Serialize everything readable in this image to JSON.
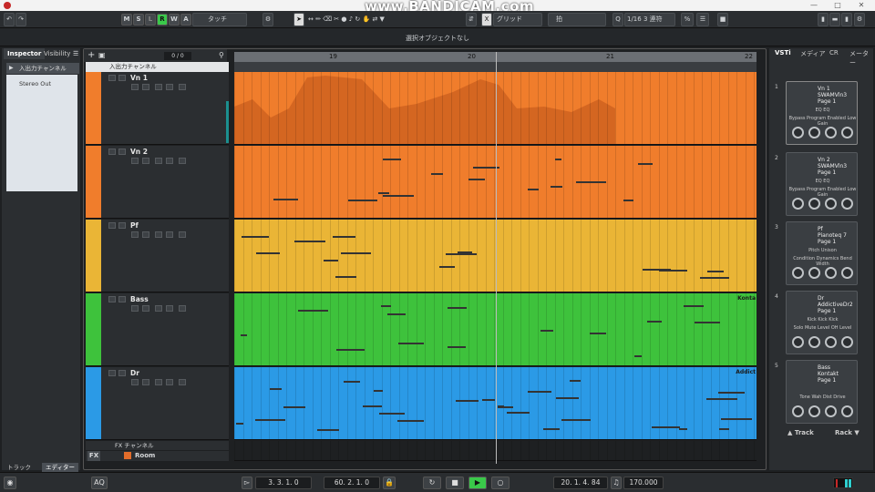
{
  "window": {
    "watermark": "www.BANDICAM.com",
    "min_btn": "—",
    "max_btn": "□",
    "close_btn": "✕"
  },
  "toolbar": {
    "modes": [
      "M",
      "S",
      "L",
      "R",
      "W",
      "A"
    ],
    "automation": "タッチ",
    "snap_label": "グリッド",
    "grid_type": "拍",
    "quantize": "1/16 3 連符"
  },
  "info": {
    "status": "選択オブジェクトなし"
  },
  "inspector": {
    "tabs": [
      "Inspector",
      "Visibility"
    ],
    "channel": "入出力チャンネル",
    "output": "Stereo Out",
    "bottom_tabs": [
      "トラック",
      "エディター"
    ]
  },
  "project": {
    "track_count": "0 / 0",
    "io_channel": "入出力チャンネル",
    "ruler": [
      "19",
      "20",
      "21",
      "22"
    ],
    "tracks": [
      {
        "name": "Vn 1",
        "color": "#f07d2c"
      },
      {
        "name": "Vn 2",
        "color": "#f07d2c"
      },
      {
        "name": "Pf",
        "color": "#eab536"
      },
      {
        "name": "Bass",
        "color": "#3ec23c"
      },
      {
        "name": "Dr",
        "color": "#2b9ae6"
      }
    ],
    "part_labels": {
      "bass": "Konta",
      "dr": "Addict"
    },
    "fx_channel": "FX チャンネル",
    "fx_track": "Room",
    "fx_label": "FX"
  },
  "rack": {
    "tabs": [
      "VSTi",
      "メディア",
      "CR",
      "メーター"
    ],
    "instruments": [
      {
        "num": "1",
        "name": "Vn 1",
        "plugin": "SWAMVln3",
        "page": "Page 1",
        "params": "Bypass  Program  Enabled  Low Gain",
        "extra": "EQ      EQ"
      },
      {
        "num": "2",
        "name": "Vn 2",
        "plugin": "SWAMVln3",
        "page": "Page 1",
        "params": "Bypass  Program  Enabled  Low Gain",
        "extra": "EQ      EQ"
      },
      {
        "num": "3",
        "name": "Pf",
        "plugin": "Pianoteq 7",
        "page": "Page 1",
        "params": "Condition Dynamics  Bend  Width",
        "extra": "Pitch   Unison"
      },
      {
        "num": "4",
        "name": "Dr",
        "plugin": "AddictiveDr2",
        "page": "Page 1",
        "params": "Solo   Mute   Level   OH Level",
        "extra": "Kick   Kick   Kick"
      },
      {
        "num": "5",
        "name": "Bass",
        "plugin": "Kontakt",
        "page": "Page 1",
        "params": "Tone   Wah   Dist   Drive",
        "extra": ""
      }
    ],
    "footer_track": "▲ Track",
    "footer_rack": "Rack ▼"
  },
  "transport": {
    "left_locator": "3. 3. 1.   0",
    "right_locator": "60. 2. 1.   0",
    "position": "20. 1. 4.  84",
    "tempo": "170.000",
    "aq": "AQ"
  }
}
